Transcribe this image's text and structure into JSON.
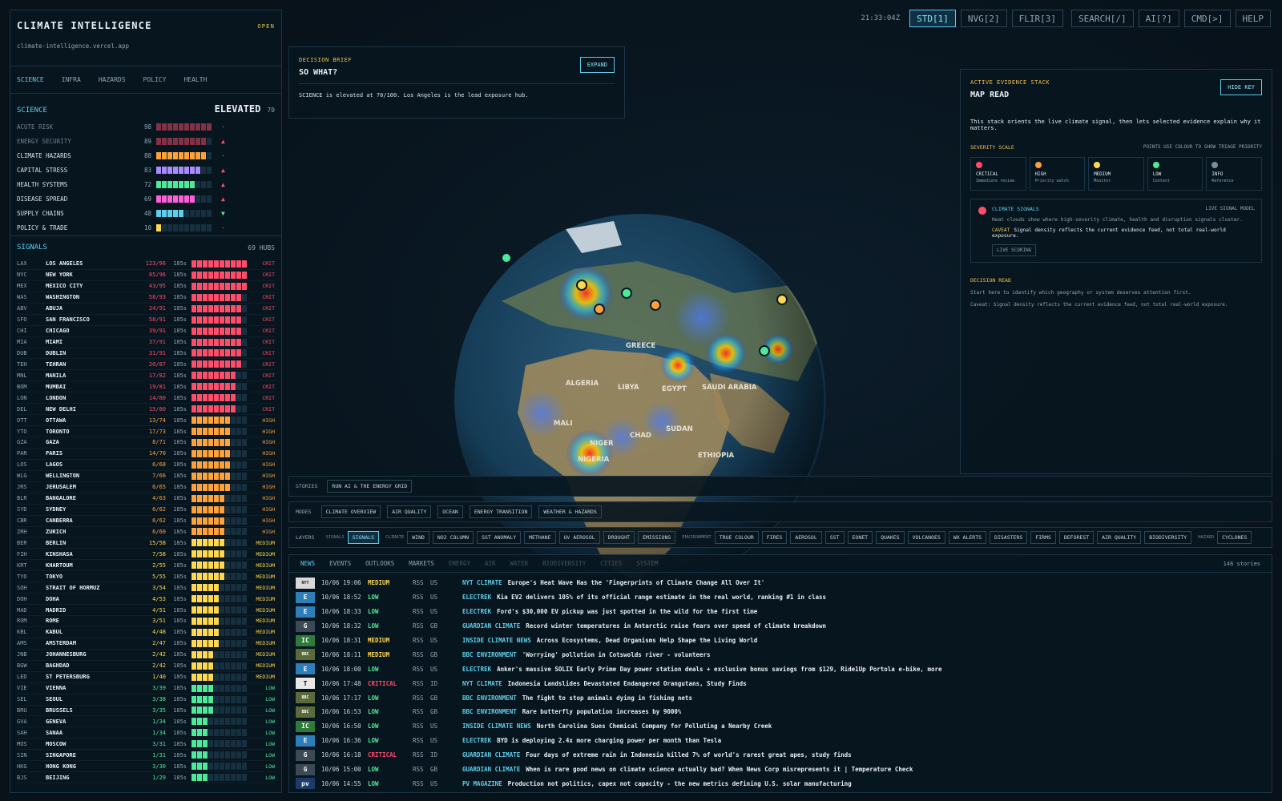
{
  "colors": {
    "crit": "#ff4d6a",
    "high": "#ffa23a",
    "medium": "#ffd84d",
    "low": "#4dea9a",
    "info": "#7d8c99",
    "accent": "#5fd0ec"
  },
  "topbar": {
    "clock": "21:33:04Z",
    "buttons": [
      "STD[1]",
      "NVG[2]",
      "FLIR[3]",
      "SEARCH[/]",
      "AI[?]",
      "CMD[>]",
      "HELP"
    ],
    "active": 0
  },
  "brand": {
    "title": "CLIMATE INTELLIGENCE",
    "status": "OPEN",
    "url": "climate-intelligence.vercel.app"
  },
  "category_tabs": [
    "SCIENCE",
    "INFRA",
    "HAZARDS",
    "POLICY",
    "HEALTH"
  ],
  "science": {
    "title": "SCIENCE",
    "state": "ELEVATED",
    "score": "70",
    "metrics": [
      {
        "name": "ACUTE RISK",
        "value": "98",
        "fill": 0.98,
        "color": "#ff4d6a",
        "trend": "·",
        "dim": true
      },
      {
        "name": "ENERGY SECURITY",
        "value": "89",
        "fill": 0.89,
        "color": "#ff4d6a",
        "trend": "▲",
        "dim": true
      },
      {
        "name": "CLIMATE HAZARDS",
        "value": "88",
        "fill": 0.88,
        "color": "#ffa23a",
        "trend": "·"
      },
      {
        "name": "CAPITAL STRESS",
        "value": "83",
        "fill": 0.83,
        "color": "#a98bff",
        "trend": "▲"
      },
      {
        "name": "HEALTH SYSTEMS",
        "value": "72",
        "fill": 0.72,
        "color": "#4dea9a",
        "trend": "▲"
      },
      {
        "name": "DISEASE SPREAD",
        "value": "69",
        "fill": 0.69,
        "color": "#ff5fd6",
        "trend": "▲"
      },
      {
        "name": "SUPPLY CHAINS",
        "value": "48",
        "fill": 0.48,
        "color": "#5fd0ec",
        "trend": "▼"
      },
      {
        "name": "POLICY & TRADE",
        "value": "10",
        "fill": 0.1,
        "color": "#ffd84d",
        "trend": "·"
      }
    ]
  },
  "signals": {
    "title": "SIGNALS",
    "hubs": "69 HUBS",
    "age": "185s",
    "rows": [
      [
        "LAX",
        "LOS ANGELES",
        "123/96",
        "CRIT"
      ],
      [
        "NYC",
        "NEW YORK",
        "85/96",
        "CRIT"
      ],
      [
        "MEX",
        "MEXICO CITY",
        "43/95",
        "CRIT"
      ],
      [
        "WAS",
        "WASHINGTON",
        "58/93",
        "CRIT"
      ],
      [
        "ABV",
        "ABUJA",
        "24/91",
        "CRIT"
      ],
      [
        "SFO",
        "SAN FRANCISCO",
        "58/91",
        "CRIT"
      ],
      [
        "CHI",
        "CHICAGO",
        "39/91",
        "CRIT"
      ],
      [
        "MIA",
        "MIAMI",
        "37/91",
        "CRIT"
      ],
      [
        "DUB",
        "DUBLIN",
        "31/91",
        "CRIT"
      ],
      [
        "TEH",
        "TEHRAN",
        "20/87",
        "CRIT"
      ],
      [
        "MNL",
        "MANILA",
        "17/82",
        "CRIT"
      ],
      [
        "BOM",
        "MUMBAI",
        "19/81",
        "CRIT"
      ],
      [
        "LON",
        "LONDON",
        "14/80",
        "CRIT"
      ],
      [
        "DEL",
        "NEW DELHI",
        "15/80",
        "CRIT"
      ],
      [
        "OTT",
        "OTTAWA",
        "13/74",
        "HIGH"
      ],
      [
        "YTO",
        "TORONTO",
        "17/73",
        "HIGH"
      ],
      [
        "GZA",
        "GAZA",
        "8/71",
        "HIGH"
      ],
      [
        "PAR",
        "PARIS",
        "14/70",
        "HIGH"
      ],
      [
        "LOS",
        "LAGOS",
        "6/68",
        "HIGH"
      ],
      [
        "WLG",
        "WELLINGTON",
        "7/66",
        "HIGH"
      ],
      [
        "JRS",
        "JERUSALEM",
        "6/65",
        "HIGH"
      ],
      [
        "BLR",
        "BANGALORE",
        "4/63",
        "HIGH"
      ],
      [
        "SYD",
        "SYDNEY",
        "6/62",
        "HIGH"
      ],
      [
        "CBR",
        "CANBERRA",
        "6/62",
        "HIGH"
      ],
      [
        "ZRH",
        "ZURICH",
        "6/60",
        "HIGH"
      ],
      [
        "BER",
        "BERLIN",
        "15/58",
        "MEDIUM"
      ],
      [
        "FIH",
        "KINSHASA",
        "7/58",
        "MEDIUM"
      ],
      [
        "KRT",
        "KHARTOUM",
        "2/55",
        "MEDIUM"
      ],
      [
        "TYO",
        "TOKYO",
        "5/55",
        "MEDIUM"
      ],
      [
        "SOH",
        "STRAIT OF HORMUZ",
        "3/54",
        "MEDIUM"
      ],
      [
        "DOH",
        "DOHA",
        "4/53",
        "MEDIUM"
      ],
      [
        "MAD",
        "MADRID",
        "4/51",
        "MEDIUM"
      ],
      [
        "ROM",
        "ROME",
        "3/51",
        "MEDIUM"
      ],
      [
        "KBL",
        "KABUL",
        "4/48",
        "MEDIUM"
      ],
      [
        "AMS",
        "AMSTERDAM",
        "2/47",
        "MEDIUM"
      ],
      [
        "JNB",
        "JOHANNESBURG",
        "2/42",
        "MEDIUM"
      ],
      [
        "BGW",
        "BAGHDAD",
        "2/42",
        "MEDIUM"
      ],
      [
        "LED",
        "ST PETERSBURG",
        "1/40",
        "MEDIUM"
      ],
      [
        "VIE",
        "VIENNA",
        "3/39",
        "LOW"
      ],
      [
        "SEL",
        "SEOUL",
        "3/38",
        "LOW"
      ],
      [
        "BRU",
        "BRUSSELS",
        "3/35",
        "LOW"
      ],
      [
        "GVA",
        "GENEVA",
        "1/34",
        "LOW"
      ],
      [
        "SAH",
        "SANAA",
        "1/34",
        "LOW"
      ],
      [
        "MOS",
        "MOSCOW",
        "3/31",
        "LOW"
      ],
      [
        "SIN",
        "SINGAPORE",
        "1/31",
        "LOW"
      ],
      [
        "HKG",
        "HONG KONG",
        "3/30",
        "LOW"
      ],
      [
        "BJS",
        "BEIJING",
        "1/29",
        "LOW"
      ]
    ]
  },
  "brief": {
    "eyebrow": "DECISION BRIEF",
    "title": "SO WHAT?",
    "expand": "EXPAND",
    "text": "SCIENCE is elevated at 70/100. Los Angeles is the lead exposure hub."
  },
  "evidence": {
    "eyebrow": "ACTIVE EVIDENCE STACK",
    "title": "MAP READ",
    "hide": "HIDE KEY",
    "desc": "This stack orients the live climate signal, then lets selected evidence explain why it matters.",
    "sev_label": "SEVERITY SCALE",
    "sev_hint": "POINTS USE COLOUR TO SHOW TRIAGE PRIORITY",
    "sevs": [
      {
        "name": "CRITICAL",
        "sub": "Immediate review",
        "color": "#ff4d6a"
      },
      {
        "name": "HIGH",
        "sub": "Priority watch",
        "color": "#ffa23a"
      },
      {
        "name": "MEDIUM",
        "sub": "Monitor",
        "color": "#ffd84d"
      },
      {
        "name": "LOW",
        "sub": "Context",
        "color": "#4dea9a"
      },
      {
        "name": "INFO",
        "sub": "Reference",
        "color": "#7d8c99"
      }
    ],
    "sig_title": "CLIMATE SIGNALS",
    "sig_model": "LIVE SIGNAL MODEL",
    "sig_text": "Heat clouds show where high-severity climate, health and disruption signals cluster.",
    "caveat_label": "CAVEAT",
    "caveat": "Signal density reflects the current evidence feed, not total real-world exposure.",
    "live": "LIVE SCORING",
    "dr_title": "DECISION READ",
    "dr1": "Start here to identify which geography or system deserves attention first.",
    "dr2": "Caveat: Signal density reflects the current evidence feed, not total real-world exposure."
  },
  "globe_labels": [
    "LIBYA",
    "EGYPT",
    "SAUDI ARABIA",
    "MALI",
    "NIGER",
    "CHAD",
    "SUDAN",
    "ETHIOPIA",
    "NIGERIA",
    "ALGERIA",
    "GREECE"
  ],
  "stories": {
    "label": "STORIES",
    "items": [
      "RUN AI & THE ENERGY GRID"
    ]
  },
  "modes": {
    "label": "MODES",
    "items": [
      "CLIMATE OVERVIEW",
      "AIR QUALITY",
      "OCEAN",
      "ENERGY TRANSITION",
      "WEATHER & HAZARDS"
    ]
  },
  "layers": {
    "label": "LAYERS",
    "groups": [
      {
        "name": "SIGNALS",
        "items": [
          "SIGNALS"
        ],
        "on": [
          0
        ]
      },
      {
        "name": "CLIMATE",
        "items": [
          "WIND",
          "NO2 COLUMN",
          "SST ANOMALY",
          "METHANE",
          "UV AEROSOL",
          "DROUGHT",
          "EMISSIONS"
        ]
      },
      {
        "name": "ENVIRONMENT",
        "items": [
          "TRUE COLOUR",
          "FIRES",
          "AEROSOL",
          "SST",
          "EONET",
          "QUAKES",
          "VOLCANOES",
          "WX ALERTS",
          "DISASTERS",
          "FIRMS",
          "DEFOREST",
          "AIR QUALITY",
          "BIODIVERSITY"
        ]
      },
      {
        "name": "HAZARD",
        "items": [
          "CYCLONES"
        ]
      }
    ]
  },
  "news": {
    "tabs": [
      "NEWS",
      "EVENTS",
      "OUTLOOKS",
      "MARKETS",
      "ENERGY",
      "AIR",
      "WATER",
      "BIODIVERSITY",
      "CITIES",
      "SYSTEM"
    ],
    "dim_from": 4,
    "count": "146 stories",
    "rows": [
      [
        "10/06 19:06",
        "MEDIUM",
        "US",
        "NYT CLIMATE",
        "Europe's Heat Wave Has the 'Fingerprints of Climate Change All Over It'",
        "NYT"
      ],
      [
        "10/06 18:52",
        "LOW",
        "US",
        "ELECTREK",
        "Kia EV2 delivers 105% of its official range estimate in the real world, ranking #1 in class",
        "E"
      ],
      [
        "10/06 18:33",
        "LOW",
        "US",
        "ELECTREK",
        "Ford's $30,000 EV pickup was just spotted in the wild for the first time",
        "E"
      ],
      [
        "10/06 18:32",
        "LOW",
        "GB",
        "GUARDIAN CLIMATE",
        "Record winter temperatures in Antarctic raise fears over speed of climate breakdown",
        "G"
      ],
      [
        "10/06 18:31",
        "MEDIUM",
        "US",
        "INSIDE CLIMATE NEWS",
        "Across Ecosystems, Dead Organisms Help Shape the Living World",
        "IC"
      ],
      [
        "10/06 18:11",
        "MEDIUM",
        "GB",
        "BBC ENVIRONMENT",
        "'Worrying' pollution in Cotswolds river - volunteers",
        "BBC"
      ],
      [
        "10/06 18:00",
        "LOW",
        "US",
        "ELECTREK",
        "Anker's massive SOLIX Early Prime Day power station deals + exclusive bonus savings from $129, Ride1Up Portola e-bike, more",
        "E"
      ],
      [
        "10/06 17:48",
        "CRITICAL",
        "ID",
        "NYT CLIMATE",
        "Indonesia Landslides Devastated Endangered Orangutans, Study Finds",
        "T"
      ],
      [
        "10/06 17:17",
        "LOW",
        "GB",
        "BBC ENVIRONMENT",
        "The fight to stop animals dying in fishing nets",
        "BBC"
      ],
      [
        "10/06 16:53",
        "LOW",
        "GB",
        "BBC ENVIRONMENT",
        "Rare butterfly population increases by 9000%",
        "BBC"
      ],
      [
        "10/06 16:50",
        "LOW",
        "US",
        "INSIDE CLIMATE NEWS",
        "North Carolina Sues Chemical Company for Polluting a Nearby Creek",
        "IC"
      ],
      [
        "10/06 16:36",
        "LOW",
        "US",
        "ELECTREK",
        "BYD is deploying 2.4x more charging power per month than Tesla",
        "E"
      ],
      [
        "10/06 16:18",
        "CRITICAL",
        "ID",
        "GUARDIAN CLIMATE",
        "Four days of extreme rain in Indonesia killed 7% of world's rarest great apes, study finds",
        "G"
      ],
      [
        "10/06 15:00",
        "LOW",
        "GB",
        "GUARDIAN CLIMATE",
        "When is rare good news on climate science actually bad? When News Corp misrepresents it | Temperature Check",
        "G"
      ],
      [
        "10/06 14:55",
        "LOW",
        "US",
        "PV MAGAZINE",
        "Production not politics, capex not capacity - the new metrics defining U.S. solar manufacturing",
        "pv"
      ]
    ]
  }
}
